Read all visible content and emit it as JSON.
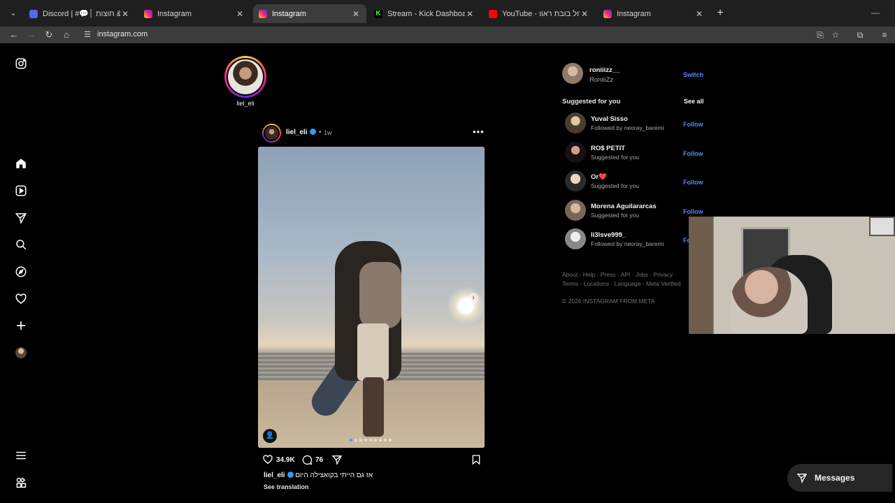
{
  "browser": {
    "tabs": [
      {
        "title": "Discord | #💬│ מיסים & חוצות",
        "favicon": "discord-icon",
        "active": false
      },
      {
        "title": "Instagram",
        "favicon": "instagram-icon",
        "active": false
      },
      {
        "title": "Instagram",
        "favicon": "instagram-icon",
        "active": true
      },
      {
        "title": "Stream - Kick Dashboard",
        "favicon": "kick-icon",
        "active": false
      },
      {
        "title": "YouTube - האח הגדול בובת ראוו",
        "favicon": "youtube-icon",
        "active": false
      },
      {
        "title": "Instagram",
        "favicon": "instagram-icon",
        "active": false
      }
    ],
    "url": "instagram.com",
    "kick_glyph": "K"
  },
  "story": {
    "username": "liel_eli"
  },
  "post": {
    "username": "liel_eli",
    "time": "1w",
    "separator": "•",
    "likes": "34.9K",
    "comments": "76",
    "caption_user": "liel_eli",
    "caption_text": "אז גם הייתי בקואצילה היום",
    "see_translation": "See translation"
  },
  "current_user": {
    "username": "roniiizz__",
    "name": "RoniiiZz",
    "switch_label": "Switch"
  },
  "suggestions": {
    "title": "Suggested for you",
    "see_all": "See all",
    "follow_label": "Follow",
    "items": [
      {
        "username": "Yuval Sisso",
        "subtitle": "Followed by neoray_baremi"
      },
      {
        "username": "RO$ PETIT",
        "subtitle": "Suggested for you"
      },
      {
        "username": "Or❤️",
        "subtitle": "Suggested for you"
      },
      {
        "username": "Morena Aguilararcas",
        "subtitle": "Suggested for you"
      },
      {
        "username": "li3lsve999_",
        "subtitle": "Followed by neoray_baremi"
      }
    ]
  },
  "footer": {
    "links": "About · Help · Press · API · Jobs · Privacy · Terms · Locations · Language · Meta Verified",
    "copyright": "© 2026 INSTAGRAM FROM META"
  },
  "messages": {
    "label": "Messages"
  },
  "colors": {
    "accent": "#4a8df8",
    "background": "#000000",
    "verified": "#3897f0"
  }
}
